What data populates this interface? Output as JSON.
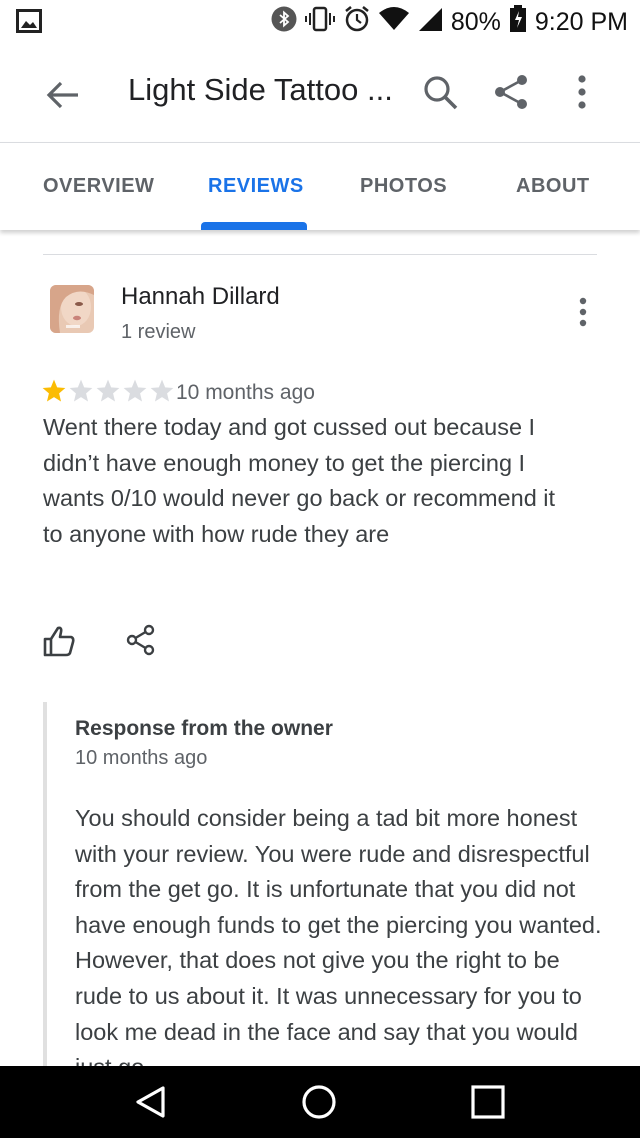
{
  "status_bar": {
    "battery": "80%",
    "time": "9:20 PM",
    "icons": [
      "image-icon",
      "bluetooth-icon",
      "vibrate-icon",
      "alarm-icon",
      "wifi-icon",
      "signal-icon",
      "battery-icon"
    ]
  },
  "app_bar": {
    "title": "Light Side Tattoo ...",
    "icons": [
      "back-arrow-icon",
      "search-icon",
      "share-icon",
      "more-vert-icon"
    ]
  },
  "tabs": {
    "items": [
      {
        "label": "OVERVIEW",
        "active": false
      },
      {
        "label": "REVIEWS",
        "active": true
      },
      {
        "label": "PHOTOS",
        "active": false
      },
      {
        "label": "ABOUT",
        "active": false
      }
    ]
  },
  "review": {
    "reviewer_name": "Hannah Dillard",
    "review_count": "1 review",
    "rating": 1,
    "rating_max": 5,
    "time_ago": "10 months ago",
    "text": "Went there today and got cussed out because I didn’t have enough money to get the piercing I wants 0/10 would never go back or recommend it to anyone with how rude they are"
  },
  "owner_response": {
    "title": "Response from the owner",
    "time_ago": "10 months ago",
    "text": "You should consider being a tad bit more honest with your review. You were rude and disrespectful from the get go. It is unfortunate that you did not have enough funds to get the piercing you wanted. However, that does not give you the right to be rude to us about it. It was unnecessary for you to look me dead in the face and say that you would just go"
  },
  "colors": {
    "accent": "#1a73e8",
    "star_filled": "#fbbc04",
    "star_empty": "#dadce0",
    "text_secondary": "#5f6368"
  }
}
